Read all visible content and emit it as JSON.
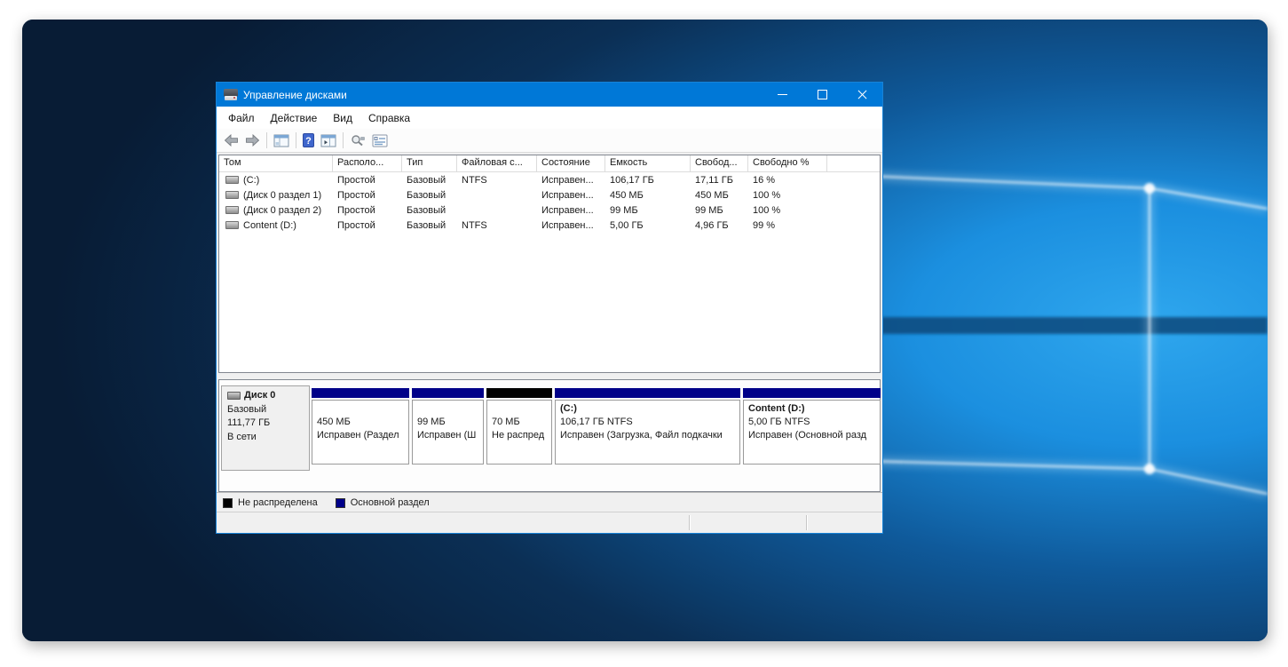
{
  "window": {
    "title": "Управление дисками",
    "menu": {
      "items": [
        "Файл",
        "Действие",
        "Вид",
        "Справка"
      ]
    },
    "toolbar": {
      "icons": [
        "back-icon",
        "forward-icon",
        "console-tree-icon",
        "help-icon",
        "action-pane-icon",
        "search-icon",
        "properties-icon"
      ]
    },
    "volume_table": {
      "columns": [
        "Том",
        "Располо...",
        "Тип",
        "Файловая с...",
        "Состояние",
        "Емкость",
        "Свобод...",
        "Свободно %"
      ],
      "rows": [
        {
          "volume": "(C:)",
          "layout": "Простой",
          "type": "Базовый",
          "fs": "NTFS",
          "status": "Исправен...",
          "capacity": "106,17 ГБ",
          "free": "17,11 ГБ",
          "free_pct": "16 %"
        },
        {
          "volume": "(Диск 0 раздел 1)",
          "layout": "Простой",
          "type": "Базовый",
          "fs": "",
          "status": "Исправен...",
          "capacity": "450 МБ",
          "free": "450 МБ",
          "free_pct": "100 %"
        },
        {
          "volume": "(Диск 0 раздел 2)",
          "layout": "Простой",
          "type": "Базовый",
          "fs": "",
          "status": "Исправен...",
          "capacity": "99 МБ",
          "free": "99 МБ",
          "free_pct": "100 %"
        },
        {
          "volume": "Content (D:)",
          "layout": "Простой",
          "type": "Базовый",
          "fs": "NTFS",
          "status": "Исправен...",
          "capacity": "5,00 ГБ",
          "free": "4,96 ГБ",
          "free_pct": "99 %"
        }
      ]
    },
    "disk_panel": {
      "label": {
        "name": "Диск 0",
        "type": "Базовый",
        "size": "111,77 ГБ",
        "status": "В сети"
      },
      "partitions": [
        {
          "name": "",
          "size": "450 МБ",
          "status": "Исправен (Раздел",
          "bar_color": "#000089"
        },
        {
          "name": "",
          "size": "99 МБ",
          "status": "Исправен (Ш",
          "bar_color": "#000089"
        },
        {
          "name": "",
          "size": "70 МБ",
          "status": "Не распред",
          "bar_color": "#000000"
        },
        {
          "name": "(C:)",
          "size": "106,17 ГБ NTFS",
          "status": "Исправен (Загрузка, Файл подкачки",
          "bar_color": "#000089"
        },
        {
          "name": "Content  (D:)",
          "size": "5,00 ГБ NTFS",
          "status": "Исправен (Основной разд",
          "bar_color": "#000089"
        }
      ]
    },
    "legend": {
      "items": [
        {
          "label": "Не распределена",
          "color": "#000000"
        },
        {
          "label": "Основной раздел",
          "color": "#000089"
        }
      ]
    }
  },
  "colors": {
    "titlebar": "#0078d7",
    "window_border": "#1883d7",
    "primary_partition": "#000089",
    "unallocated": "#000000",
    "wallpaper_bright": "#1b8fdf",
    "wallpaper_dark": "#081c35"
  }
}
